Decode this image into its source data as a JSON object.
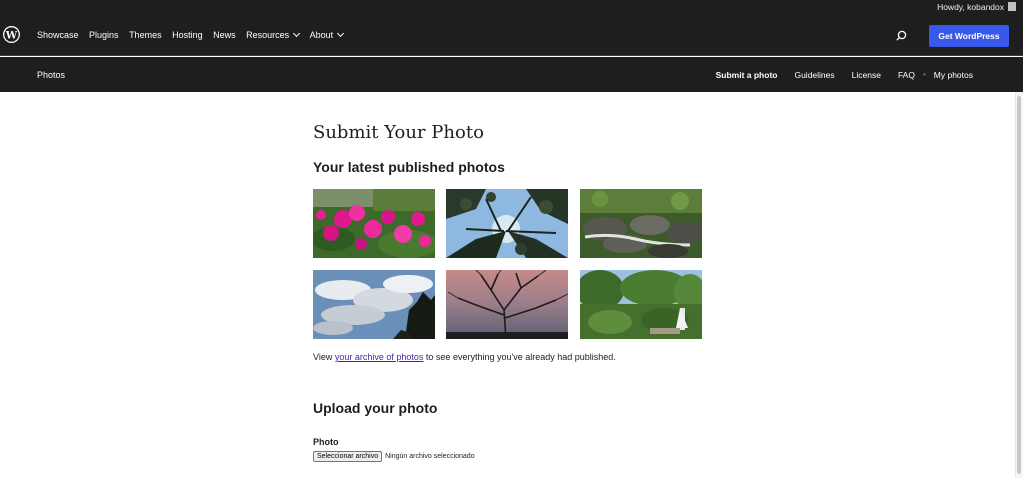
{
  "admin_bar": {
    "howdy": "Howdy, kobandox"
  },
  "global_nav": {
    "items": [
      {
        "label": "Showcase",
        "has_dropdown": false
      },
      {
        "label": "Plugins",
        "has_dropdown": false
      },
      {
        "label": "Themes",
        "has_dropdown": false
      },
      {
        "label": "Hosting",
        "has_dropdown": false
      },
      {
        "label": "News",
        "has_dropdown": false
      },
      {
        "label": "Resources",
        "has_dropdown": true
      },
      {
        "label": "About",
        "has_dropdown": true
      }
    ],
    "cta": "Get WordPress"
  },
  "local_nav": {
    "title": "Photos",
    "items": [
      "Submit a photo",
      "Guidelines",
      "License",
      "FAQ",
      "My photos"
    ]
  },
  "page": {
    "title": "Submit Your Photo",
    "latest_heading": "Your latest published photos",
    "photos": [
      "photo-pink-flowers",
      "photo-tree-canopy-sky",
      "photo-rocks-stream",
      "photo-clouds-sky",
      "photo-bare-tree-dusk",
      "photo-garden-shrubs"
    ],
    "archive_pre": "View ",
    "archive_link": "your archive of photos",
    "archive_post": " to see everything you've already had published.",
    "upload_heading": "Upload your photo",
    "photo_label": "Photo",
    "file_button": "Seleccionar archivo",
    "file_status": "Ningún archivo seleccionado"
  },
  "colors": {
    "nav_bg": "#1e1e1e",
    "cta_blue": "#3858e9",
    "link_visited": "#4b1fa0"
  }
}
